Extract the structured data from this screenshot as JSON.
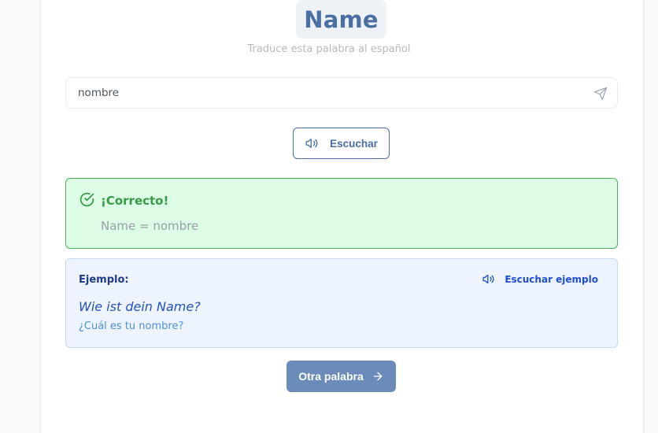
{
  "colors": {
    "accent": "#4a6fa5",
    "success_bg": "#dcfce6",
    "success_border": "#4ab35a",
    "success_text": "#3a9c46",
    "example_bg": "#edf4fd",
    "example_border": "#c4dbf3",
    "next_button_bg": "#6b8cbb"
  },
  "word": "Name",
  "instruction": "Traduce esta palabra al español",
  "answer": {
    "value": "nombre",
    "submit_icon": "send-icon"
  },
  "listen_button": {
    "label": "Escuchar",
    "icon": "speaker-icon"
  },
  "feedback": {
    "icon": "check-circle-icon",
    "title": "¡Correcto!",
    "equation": "Name = nombre"
  },
  "example": {
    "label": "Ejemplo:",
    "listen_label": "Escuchar ejemplo",
    "listen_icon": "speaker-icon",
    "sentence": "Wie ist dein Name?",
    "translation": "¿Cuál es tu nombre?"
  },
  "next_button": {
    "label": "Otra palabra",
    "icon": "arrow-right-icon"
  }
}
